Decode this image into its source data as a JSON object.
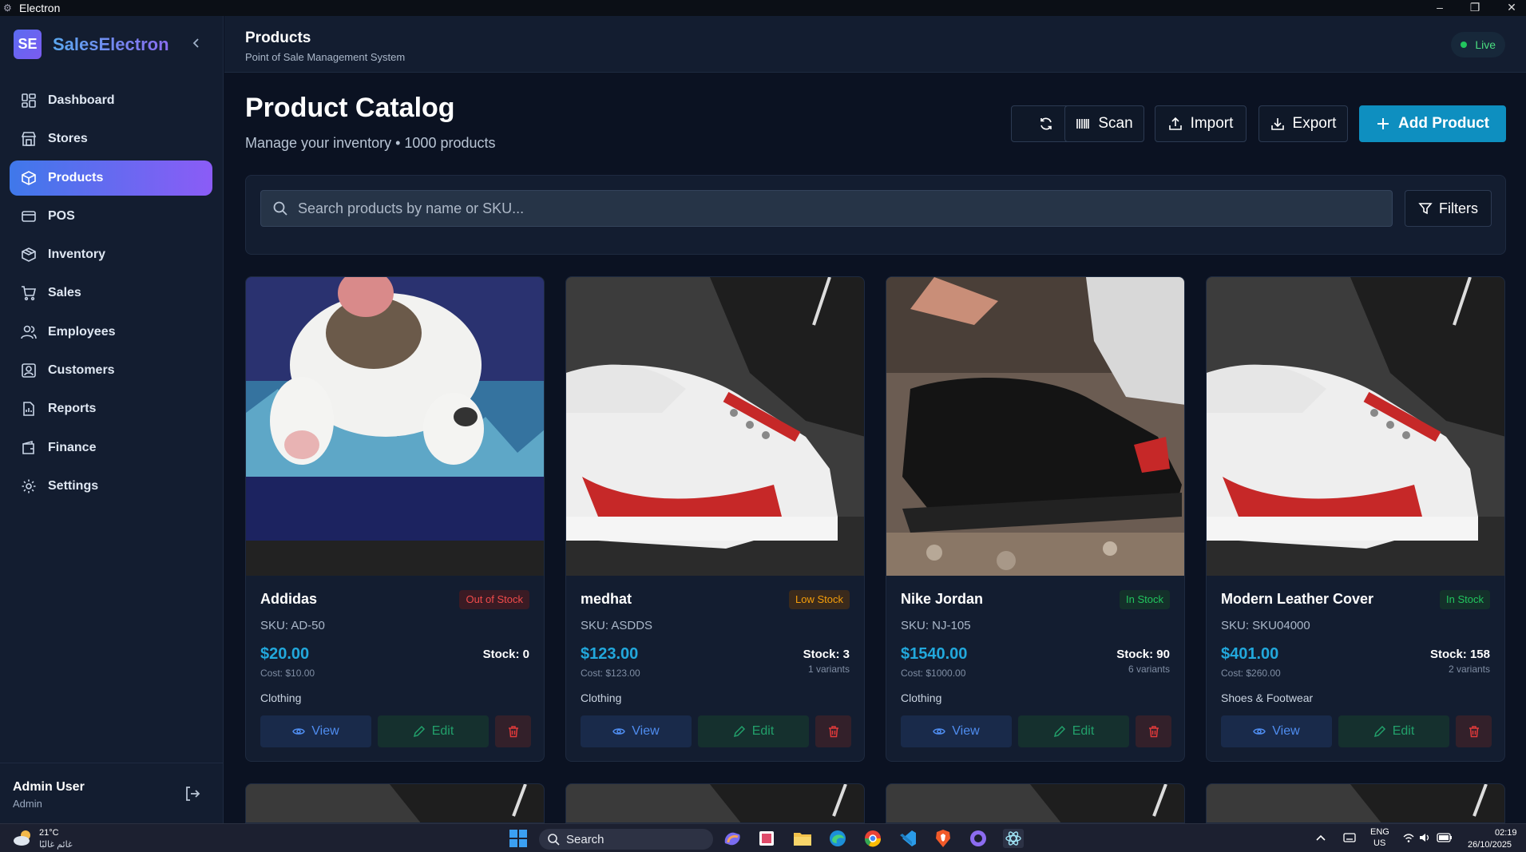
{
  "window": {
    "title": "Electron"
  },
  "brand": {
    "logo_text": "SE",
    "name": "SalesElectron"
  },
  "nav": [
    {
      "label": "Dashboard",
      "icon": "dashboard-icon",
      "active": false
    },
    {
      "label": "Stores",
      "icon": "store-icon",
      "active": false
    },
    {
      "label": "Products",
      "icon": "box-icon",
      "active": true
    },
    {
      "label": "POS",
      "icon": "credit-card-icon",
      "active": false
    },
    {
      "label": "Inventory",
      "icon": "package-icon",
      "active": false
    },
    {
      "label": "Sales",
      "icon": "cart-icon",
      "active": false
    },
    {
      "label": "Employees",
      "icon": "users-icon",
      "active": false
    },
    {
      "label": "Customers",
      "icon": "contact-icon",
      "active": false
    },
    {
      "label": "Reports",
      "icon": "report-icon",
      "active": false
    },
    {
      "label": "Finance",
      "icon": "wallet-icon",
      "active": false
    },
    {
      "label": "Settings",
      "icon": "gear-icon",
      "active": false
    }
  ],
  "user": {
    "name": "Admin User",
    "role": "Admin"
  },
  "header": {
    "title": "Products",
    "subtitle": "Point of Sale Management System",
    "status": "Live"
  },
  "page": {
    "title": "Product Catalog",
    "subtitle": "Manage your inventory • 1000 products"
  },
  "toolbar": {
    "scan": "Scan",
    "import": "Import",
    "export": "Export",
    "add": "Add Product"
  },
  "search": {
    "placeholder": "Search products by name or SKU...",
    "filters": "Filters"
  },
  "products": [
    {
      "name": "Addidas",
      "badge": "Out of Stock",
      "status": "out",
      "sku": "SKU: AD-50",
      "price": "$20.00",
      "cost": "Cost: $10.00",
      "stock": "Stock: 0",
      "variants": "",
      "category": "Clothing",
      "image": "cat-photo"
    },
    {
      "name": "medhat",
      "badge": "Low Stock",
      "status": "low",
      "sku": "SKU: ASDDS",
      "price": "$123.00",
      "cost": "Cost: $123.00",
      "stock": "Stock: 3",
      "variants": "1 variants",
      "category": "Clothing",
      "image": "white-red-sneaker-photo"
    },
    {
      "name": "Nike Jordan",
      "badge": "In Stock",
      "status": "in",
      "sku": "SKU: NJ-105",
      "price": "$1540.00",
      "cost": "Cost: $1000.00",
      "stock": "Stock: 90",
      "variants": "6 variants",
      "category": "Clothing",
      "image": "black-sneaker-photo"
    },
    {
      "name": "Modern Leather Cover",
      "badge": "In Stock",
      "status": "in",
      "sku": "SKU: SKU04000",
      "price": "$401.00",
      "cost": "Cost: $260.00",
      "stock": "Stock: 158",
      "variants": "2 variants",
      "category": "Shoes & Footwear",
      "image": "white-red-sneaker-photo"
    }
  ],
  "card_actions": {
    "view": "View",
    "edit": "Edit"
  },
  "taskbar": {
    "temperature": "21°C",
    "weather_desc": "غائم غالبًا",
    "search": "Search",
    "lang_top": "ENG",
    "lang_bottom": "US",
    "time": "02:19",
    "date": "26/10/2025"
  },
  "colors": {
    "accent": "#0e8fc0",
    "active_nav_start": "#3f78ea",
    "active_nav_end": "#8b5cf6",
    "live": "#22c55e"
  }
}
